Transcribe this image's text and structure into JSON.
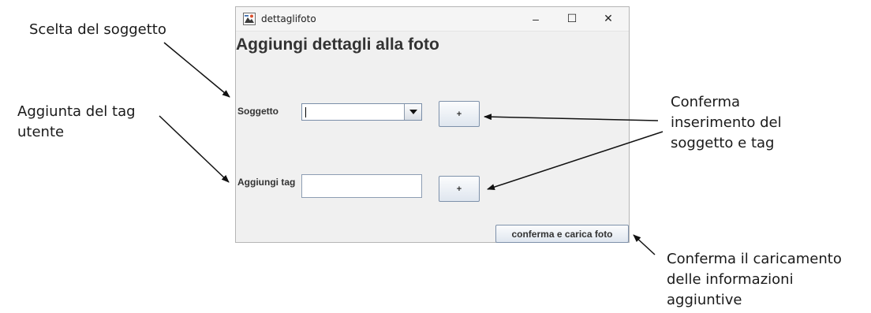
{
  "annotations": {
    "subject_choice": "Scelta del soggetto",
    "user_tag_line1": "Aggiunta del tag",
    "user_tag_line2": "utente",
    "confirm_insert_line1": "Conferma",
    "confirm_insert_line2": "inserimento del",
    "confirm_insert_line3": "soggetto e tag",
    "confirm_upload_line1": "Conferma il caricamento",
    "confirm_upload_line2": "delle informazioni",
    "confirm_upload_line3": "aggiuntive"
  },
  "window": {
    "title": "dettaglifoto",
    "minimize_glyph": "–",
    "maximize_glyph": "☐",
    "close_glyph": "✕",
    "app_icon": "java-icon"
  },
  "form": {
    "heading": "Aggiungi dettagli alla foto",
    "subject_label": "Soggetto",
    "subject_value": "",
    "add_subject_label": "+",
    "tag_label": "Aggiungi tag",
    "tag_value": "",
    "add_tag_label": "+",
    "confirm_upload_label": "conferma e carica foto"
  }
}
